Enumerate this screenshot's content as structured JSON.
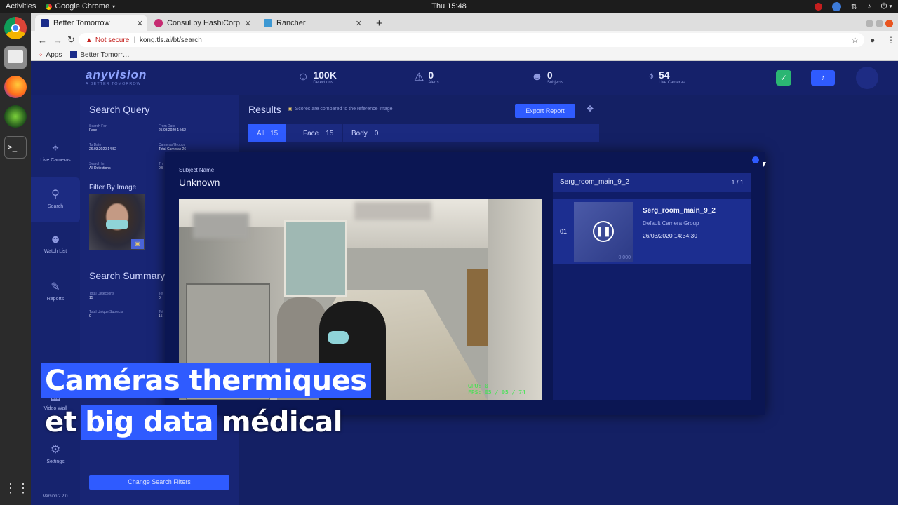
{
  "os_bar": {
    "activities": "Activities",
    "app_name": "Google Chrome",
    "clock": "Thu 15:48"
  },
  "browser": {
    "tabs": [
      {
        "label": "Better Tomorrow",
        "active": true
      },
      {
        "label": "Consul by HashiCorp",
        "active": false
      },
      {
        "label": "Rancher",
        "active": false
      }
    ],
    "new_tab": "+",
    "not_secure": "Not secure",
    "url": "kong.tls.ai/bt/search",
    "bookmarks": [
      "Apps",
      "Better Tomorr…"
    ]
  },
  "header": {
    "logo": "anyvision",
    "logo_sub": "A BETTER TOMORROW",
    "stats": [
      {
        "value": "100K",
        "label": "Detections",
        "icon": "faces-icon"
      },
      {
        "value": "0",
        "label": "Alerts",
        "icon": "alert-icon"
      },
      {
        "value": "0",
        "label": "Subjects",
        "icon": "subjects-icon"
      },
      {
        "value": "54",
        "label": "Live Cameras",
        "icon": "camera-icon"
      }
    ]
  },
  "nav": {
    "items": [
      {
        "label": "Live Cameras",
        "icon": "cctv-icon"
      },
      {
        "label": "Search",
        "icon": "search-icon",
        "active": true
      },
      {
        "label": "Watch List",
        "icon": "watchlist-icon"
      },
      {
        "label": "Reports",
        "icon": "reports-icon"
      },
      {
        "label": "Video Wall",
        "icon": "grid-icon"
      },
      {
        "label": "Settings",
        "icon": "gear-icon"
      }
    ],
    "version": "Version 2.2.0"
  },
  "query": {
    "title": "Search Query",
    "fields": [
      {
        "label": "Search For",
        "value": "Face"
      },
      {
        "label": "From Date",
        "value": "25.03.2020 14:52"
      },
      {
        "label": "To Date",
        "value": "26.03.2020 14:52"
      },
      {
        "label": "Cameras/Groups",
        "value": "Total Cameras 26"
      },
      {
        "label": "Search In",
        "value": "All Detections"
      },
      {
        "label": "Th",
        "value": "0.5"
      }
    ],
    "filter_title": "Filter By Image",
    "summary_title": "Search Summary",
    "summary": [
      {
        "label": "Total Detections",
        "value": "15"
      },
      {
        "label": "Tot",
        "value": "0"
      },
      {
        "label": "Total Unique Subjects",
        "value": "0"
      },
      {
        "label": "Tot",
        "value": "15"
      }
    ],
    "change_button": "Change Search Filters"
  },
  "results": {
    "title": "Results",
    "note": "Scores are compared to the reference image",
    "export_button": "Export Report",
    "tabs": [
      {
        "label": "All",
        "count": "15",
        "active": true
      },
      {
        "label": "Face",
        "count": "15",
        "active": false
      },
      {
        "label": "Body",
        "count": "0",
        "active": false
      }
    ]
  },
  "modal": {
    "subject_label": "Subject Name",
    "subject_name": "Unknown",
    "camera_header": "Serg_room_main_9_2",
    "pager": "1 / 1",
    "item": {
      "index": "01",
      "camera": "Serg_room_main_9_2",
      "group": "Default Camera Group",
      "time": "26/03/2020 14:34:30",
      "thumb_time": "0:000"
    },
    "video_overlay": "GPU: 0\nFPS: 05 / 05 / 74"
  },
  "captions": {
    "line1": "Caméras thermiques",
    "line2_a": "et",
    "line2_b": "big data",
    "line2_c": "médical"
  },
  "colors": {
    "accent": "#2f5bff",
    "success": "#2bb673",
    "page_bg": "#142064"
  }
}
